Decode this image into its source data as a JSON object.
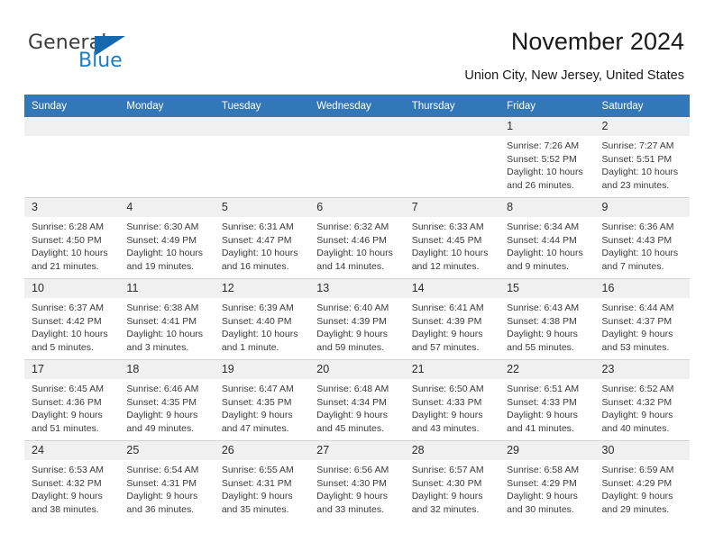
{
  "brand": {
    "name_part1": "General",
    "name_part2": "Blue",
    "logo_icon": "triangle-flag-icon"
  },
  "header": {
    "title": "November 2024",
    "location": "Union City, New Jersey, United States"
  },
  "theme": {
    "header_blue": "#3277b8",
    "brand_blue": "#1f7dc4",
    "daynum_bg": "#f0f0f0",
    "grid_line": "#cfd4d9"
  },
  "weekdays": [
    "Sunday",
    "Monday",
    "Tuesday",
    "Wednesday",
    "Thursday",
    "Friday",
    "Saturday"
  ],
  "weeks": [
    [
      {
        "day": "",
        "empty": true
      },
      {
        "day": "",
        "empty": true
      },
      {
        "day": "",
        "empty": true
      },
      {
        "day": "",
        "empty": true
      },
      {
        "day": "",
        "empty": true
      },
      {
        "day": "1",
        "sunrise": "Sunrise: 7:26 AM",
        "sunset": "Sunset: 5:52 PM",
        "daylight": "Daylight: 10 hours and 26 minutes."
      },
      {
        "day": "2",
        "sunrise": "Sunrise: 7:27 AM",
        "sunset": "Sunset: 5:51 PM",
        "daylight": "Daylight: 10 hours and 23 minutes."
      }
    ],
    [
      {
        "day": "3",
        "sunrise": "Sunrise: 6:28 AM",
        "sunset": "Sunset: 4:50 PM",
        "daylight": "Daylight: 10 hours and 21 minutes."
      },
      {
        "day": "4",
        "sunrise": "Sunrise: 6:30 AM",
        "sunset": "Sunset: 4:49 PM",
        "daylight": "Daylight: 10 hours and 19 minutes."
      },
      {
        "day": "5",
        "sunrise": "Sunrise: 6:31 AM",
        "sunset": "Sunset: 4:47 PM",
        "daylight": "Daylight: 10 hours and 16 minutes."
      },
      {
        "day": "6",
        "sunrise": "Sunrise: 6:32 AM",
        "sunset": "Sunset: 4:46 PM",
        "daylight": "Daylight: 10 hours and 14 minutes."
      },
      {
        "day": "7",
        "sunrise": "Sunrise: 6:33 AM",
        "sunset": "Sunset: 4:45 PM",
        "daylight": "Daylight: 10 hours and 12 minutes."
      },
      {
        "day": "8",
        "sunrise": "Sunrise: 6:34 AM",
        "sunset": "Sunset: 4:44 PM",
        "daylight": "Daylight: 10 hours and 9 minutes."
      },
      {
        "day": "9",
        "sunrise": "Sunrise: 6:36 AM",
        "sunset": "Sunset: 4:43 PM",
        "daylight": "Daylight: 10 hours and 7 minutes."
      }
    ],
    [
      {
        "day": "10",
        "sunrise": "Sunrise: 6:37 AM",
        "sunset": "Sunset: 4:42 PM",
        "daylight": "Daylight: 10 hours and 5 minutes."
      },
      {
        "day": "11",
        "sunrise": "Sunrise: 6:38 AM",
        "sunset": "Sunset: 4:41 PM",
        "daylight": "Daylight: 10 hours and 3 minutes."
      },
      {
        "day": "12",
        "sunrise": "Sunrise: 6:39 AM",
        "sunset": "Sunset: 4:40 PM",
        "daylight": "Daylight: 10 hours and 1 minute."
      },
      {
        "day": "13",
        "sunrise": "Sunrise: 6:40 AM",
        "sunset": "Sunset: 4:39 PM",
        "daylight": "Daylight: 9 hours and 59 minutes."
      },
      {
        "day": "14",
        "sunrise": "Sunrise: 6:41 AM",
        "sunset": "Sunset: 4:39 PM",
        "daylight": "Daylight: 9 hours and 57 minutes."
      },
      {
        "day": "15",
        "sunrise": "Sunrise: 6:43 AM",
        "sunset": "Sunset: 4:38 PM",
        "daylight": "Daylight: 9 hours and 55 minutes."
      },
      {
        "day": "16",
        "sunrise": "Sunrise: 6:44 AM",
        "sunset": "Sunset: 4:37 PM",
        "daylight": "Daylight: 9 hours and 53 minutes."
      }
    ],
    [
      {
        "day": "17",
        "sunrise": "Sunrise: 6:45 AM",
        "sunset": "Sunset: 4:36 PM",
        "daylight": "Daylight: 9 hours and 51 minutes."
      },
      {
        "day": "18",
        "sunrise": "Sunrise: 6:46 AM",
        "sunset": "Sunset: 4:35 PM",
        "daylight": "Daylight: 9 hours and 49 minutes."
      },
      {
        "day": "19",
        "sunrise": "Sunrise: 6:47 AM",
        "sunset": "Sunset: 4:35 PM",
        "daylight": "Daylight: 9 hours and 47 minutes."
      },
      {
        "day": "20",
        "sunrise": "Sunrise: 6:48 AM",
        "sunset": "Sunset: 4:34 PM",
        "daylight": "Daylight: 9 hours and 45 minutes."
      },
      {
        "day": "21",
        "sunrise": "Sunrise: 6:50 AM",
        "sunset": "Sunset: 4:33 PM",
        "daylight": "Daylight: 9 hours and 43 minutes."
      },
      {
        "day": "22",
        "sunrise": "Sunrise: 6:51 AM",
        "sunset": "Sunset: 4:33 PM",
        "daylight": "Daylight: 9 hours and 41 minutes."
      },
      {
        "day": "23",
        "sunrise": "Sunrise: 6:52 AM",
        "sunset": "Sunset: 4:32 PM",
        "daylight": "Daylight: 9 hours and 40 minutes."
      }
    ],
    [
      {
        "day": "24",
        "sunrise": "Sunrise: 6:53 AM",
        "sunset": "Sunset: 4:32 PM",
        "daylight": "Daylight: 9 hours and 38 minutes."
      },
      {
        "day": "25",
        "sunrise": "Sunrise: 6:54 AM",
        "sunset": "Sunset: 4:31 PM",
        "daylight": "Daylight: 9 hours and 36 minutes."
      },
      {
        "day": "26",
        "sunrise": "Sunrise: 6:55 AM",
        "sunset": "Sunset: 4:31 PM",
        "daylight": "Daylight: 9 hours and 35 minutes."
      },
      {
        "day": "27",
        "sunrise": "Sunrise: 6:56 AM",
        "sunset": "Sunset: 4:30 PM",
        "daylight": "Daylight: 9 hours and 33 minutes."
      },
      {
        "day": "28",
        "sunrise": "Sunrise: 6:57 AM",
        "sunset": "Sunset: 4:30 PM",
        "daylight": "Daylight: 9 hours and 32 minutes."
      },
      {
        "day": "29",
        "sunrise": "Sunrise: 6:58 AM",
        "sunset": "Sunset: 4:29 PM",
        "daylight": "Daylight: 9 hours and 30 minutes."
      },
      {
        "day": "30",
        "sunrise": "Sunrise: 6:59 AM",
        "sunset": "Sunset: 4:29 PM",
        "daylight": "Daylight: 9 hours and 29 minutes."
      }
    ]
  ]
}
